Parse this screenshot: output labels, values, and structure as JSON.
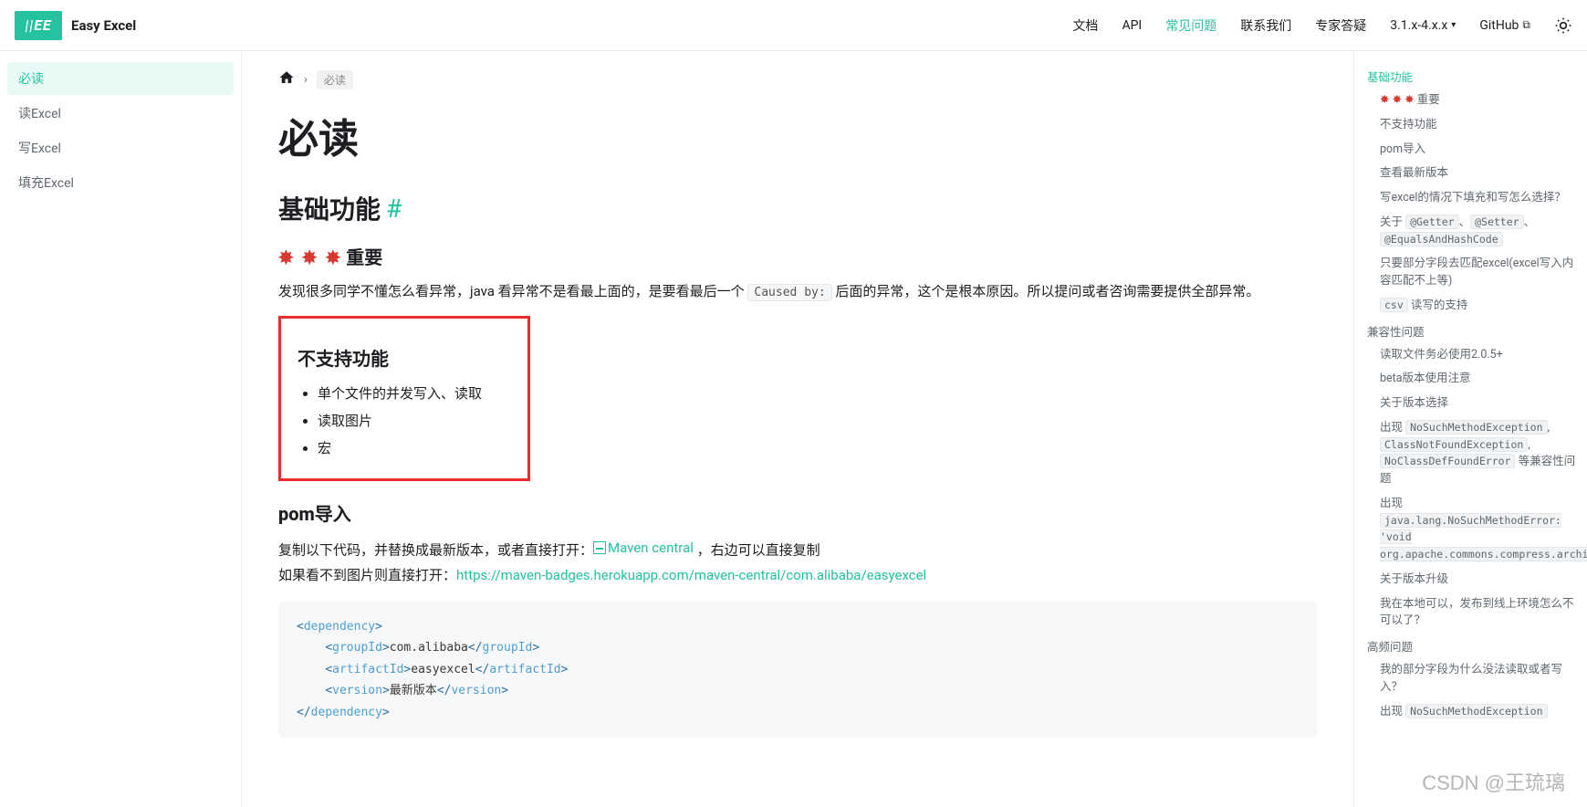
{
  "brand": {
    "logo_text": "||EE",
    "name": "Easy Excel"
  },
  "nav": {
    "docs": "文档",
    "api": "API",
    "faq": "常见问题",
    "contact": "联系我们",
    "expert": "专家答疑",
    "version": "3.1.x-4.x.x",
    "github": "GitHub"
  },
  "sidebar": {
    "items": [
      "必读",
      "读Excel",
      "写Excel",
      "填充Excel"
    ]
  },
  "breadcrumb": {
    "current": "必读"
  },
  "content": {
    "title": "必读",
    "h2_basic": "基础功能",
    "hash": "#",
    "important_label": "重要",
    "important_stars": "✸ ✸ ✸",
    "para1_a": "发现很多同学不懂怎么看异常，java 看异常不是看最上面的，是要看最后一个 ",
    "para1_code": "Caused by:",
    "para1_b": " 后面的异常，这个是根本原因。所以提问或者咨询需要提供全部异常。",
    "unsupported_title": "不支持功能",
    "unsupported_items": [
      "单个文件的并发写入、读取",
      "读取图片",
      "宏"
    ],
    "pom_title": "pom导入",
    "pom_intro_a": "复制以下代码，并替换成最新版本，或者直接打开：",
    "pom_intro_img": "Maven central",
    "pom_intro_b": " ，右边可以直接复制",
    "pom_line2_a": "如果看不到图片则直接打开：",
    "pom_line2_link": "https://maven-badges.herokuapp.com/maven-central/com.alibaba/easyexcel",
    "code": {
      "l1a": "<",
      "l1b": "dependency",
      "l1c": ">",
      "l2a": "<",
      "l2b": "groupId",
      "l2c": ">",
      "l2d": "com.alibaba",
      "l2e": "</",
      "l2f": "groupId",
      "l2g": ">",
      "l3a": "<",
      "l3b": "artifactId",
      "l3c": ">",
      "l3d": "easyexcel",
      "l3e": "</",
      "l3f": "artifactId",
      "l3g": ">",
      "l4a": "<",
      "l4b": "version",
      "l4c": ">",
      "l4d": "最新版本",
      "l4e": "</",
      "l4f": "version",
      "l4g": ">",
      "l5a": "</",
      "l5b": "dependency",
      "l5c": ">"
    }
  },
  "toc": {
    "h1": "基础功能",
    "i_stars": "✸ ✸ ✸",
    "i1": "重要",
    "i2": "不支持功能",
    "i3": "pom导入",
    "i4": "查看最新版本",
    "i5": "写excel的情况下填充和写怎么选择？",
    "i6_a": "关于 ",
    "i6_c1": "@Getter",
    "i6_sep1": "、",
    "i6_c2": "@Setter",
    "i6_sep2": "、",
    "i6_c3": "@EqualsAndHashCode",
    "i7": "只要部分字段去匹配excel(excel写入内容匹配不上等)",
    "i8_c": "csv",
    "i8_t": "读写的支持",
    "h2": "兼容性问题",
    "i9": "读取文件务必使用2.0.5+",
    "i10": "beta版本使用注意",
    "i11": "关于版本选择",
    "i12_a": "出现 ",
    "i12_c1": "NoSuchMethodException",
    "i12_s1": ", ",
    "i12_c2": "ClassNotFoundException",
    "i12_s2": ", ",
    "i12_c3": "NoClassDefFoundError",
    "i12_b": " 等兼容性问题",
    "i13_a": "出现 ",
    "i13_c": "java.lang.NoSuchMethodError: 'void org.apache.commons.compress.archivers.zip.ZipArchiveOutputStream.putArchiveEntry(org.apache.commons.compress.archivers.zip.ZipArchiveEntry)'",
    "i14": "关于版本升级",
    "i15": "我在本地可以，发布到线上环境怎么不可以了？",
    "h3": "高频问题",
    "i16": "我的部分字段为什么没法读取或者写入？",
    "i17_a": "出现 ",
    "i17_c": "NoSuchMethodException"
  },
  "watermark": "CSDN @王琉璃"
}
